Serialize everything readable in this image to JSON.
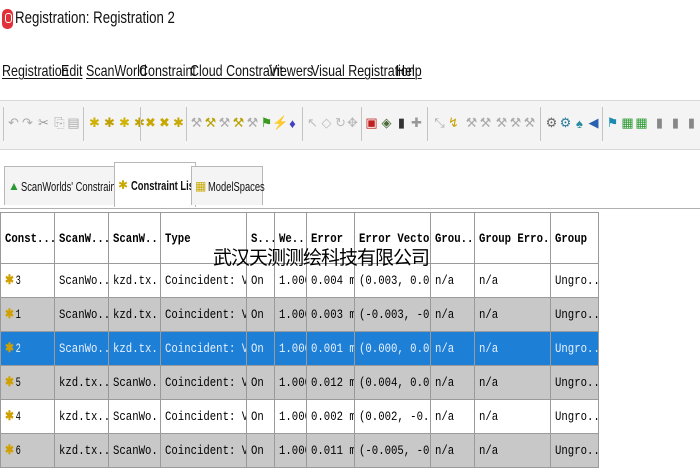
{
  "window": {
    "title": "Registration: Registration 2"
  },
  "menu": [
    "Registration",
    "Edit",
    "ScanWorld",
    "Constraint",
    "Cloud Constraint",
    "Viewers",
    "Visual Registration",
    "Help"
  ],
  "toolbar_icons": [
    "undo-icon",
    "redo-icon",
    "cut-icon",
    "copy-icon",
    "paste-icon",
    "add-scanworld-icon",
    "add-scanworld2-icon",
    "add-scanworld3-icon",
    "constraint-icon",
    "constraint2-icon",
    "constraint3-icon",
    "cloud-icon",
    "cloud2-icon",
    "cloud3-icon",
    "cloud4-icon",
    "cloud5-icon",
    "cloud6-icon",
    "register-icon",
    "view-icon",
    "view2-icon",
    "view3-icon",
    "view4-icon",
    "lock-icon",
    "scan-icon",
    "info-icon",
    "pin-icon",
    "link-icon",
    "link2-icon",
    "link3-icon",
    "link4-icon",
    "link5-icon",
    "link6-icon",
    "tool-icon",
    "tool2-icon",
    "tool3-icon",
    "tool4-icon",
    "tool5-icon",
    "grid-icon",
    "panel-icon",
    "panel2-icon",
    "panel3-icon"
  ],
  "tabs": [
    {
      "label": "ScanWorlds' Constraints",
      "icon": "scanworld-icon",
      "active": false
    },
    {
      "label": "Constraint List",
      "icon": "constraint-list-icon",
      "active": true
    },
    {
      "label": "ModelSpaces",
      "icon": "modelspace-icon",
      "active": false
    }
  ],
  "table": {
    "headers": [
      "Const...",
      "ScanW...",
      "ScanW...",
      "Type",
      "S...",
      "We...",
      "Error",
      "Error Vector",
      "Grou...",
      "Group Erro...",
      "Group"
    ],
    "rows": [
      {
        "cells": [
          "3",
          "ScanWo...",
          "kzd.tx...",
          "Coincident: Ve...",
          "On",
          "1.0000",
          "0.004 m",
          "(0.003, 0.0...",
          "n/a",
          "n/a",
          "Ungro..."
        ],
        "state": "odd"
      },
      {
        "cells": [
          "1",
          "ScanWo...",
          "kzd.tx...",
          "Coincident: Ve...",
          "On",
          "1.0000",
          "0.003 m",
          "(-0.003, -0...",
          "n/a",
          "n/a",
          "Ungro..."
        ],
        "state": "even"
      },
      {
        "cells": [
          "2",
          "ScanWo...",
          "kzd.tx...",
          "Coincident: Ve...",
          "On",
          "1.0000",
          "0.001 m",
          "(0.000, 0.0...",
          "n/a",
          "n/a",
          "Ungro..."
        ],
        "state": "selected"
      },
      {
        "cells": [
          "5",
          "kzd.tx...",
          "ScanWo...",
          "Coincident: Ve...",
          "On",
          "1.0000",
          "0.012 m",
          "(0.004, 0.0...",
          "n/a",
          "n/a",
          "Ungro..."
        ],
        "state": "even"
      },
      {
        "cells": [
          "4",
          "kzd.tx...",
          "ScanWo...",
          "Coincident: Ve...",
          "On",
          "1.0000",
          "0.002 m",
          "(0.002, -0...",
          "n/a",
          "n/a",
          "Ungro..."
        ],
        "state": "odd"
      },
      {
        "cells": [
          "6",
          "kzd.tx...",
          "ScanWo...",
          "Coincident: Ve...",
          "On",
          "1.0000",
          "0.011 m",
          "(-0.005, -0...",
          "n/a",
          "n/a",
          "Ungro..."
        ],
        "state": "even"
      }
    ]
  },
  "watermark": "武汉天测测绘科技有限公司",
  "colors": {
    "selected_row": "#1e7fd6",
    "alt_row": "#c8c8c8",
    "app_icon": "#e0303a"
  }
}
